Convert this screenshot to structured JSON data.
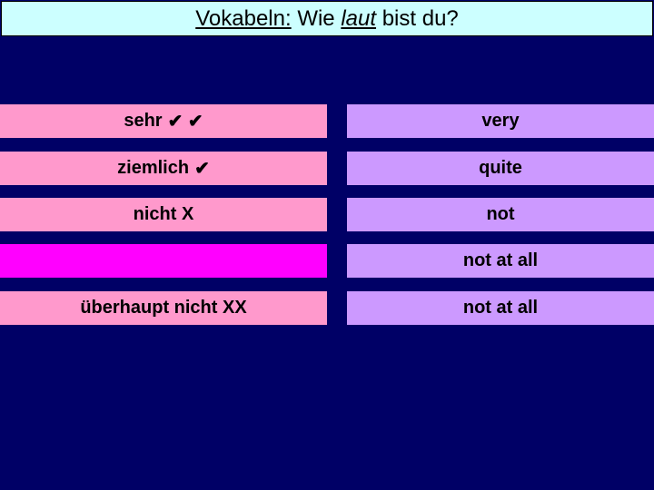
{
  "title": {
    "part1": "Vokabeln:",
    "part2": " Wie ",
    "part3": "laut",
    "part4": " bist du?"
  },
  "colors": {
    "background": "#000066",
    "title_bg": "#ccffff",
    "german_bg": "#ff99cc",
    "german_blank_bg": "#ff00ff",
    "english_bg": "#cc99ff"
  },
  "rows": [
    {
      "german": "sehr",
      "german_icons": "✔ ✔",
      "english": "very"
    },
    {
      "german": "ziemlich",
      "german_icons": "✔",
      "english": "quite"
    },
    {
      "german": "nicht X",
      "german_icons": "",
      "english": "not"
    },
    {
      "german": "",
      "german_icons": "",
      "english": "not at all"
    },
    {
      "german": "überhaupt nicht XX",
      "german_icons": "",
      "english": "not at all"
    }
  ]
}
